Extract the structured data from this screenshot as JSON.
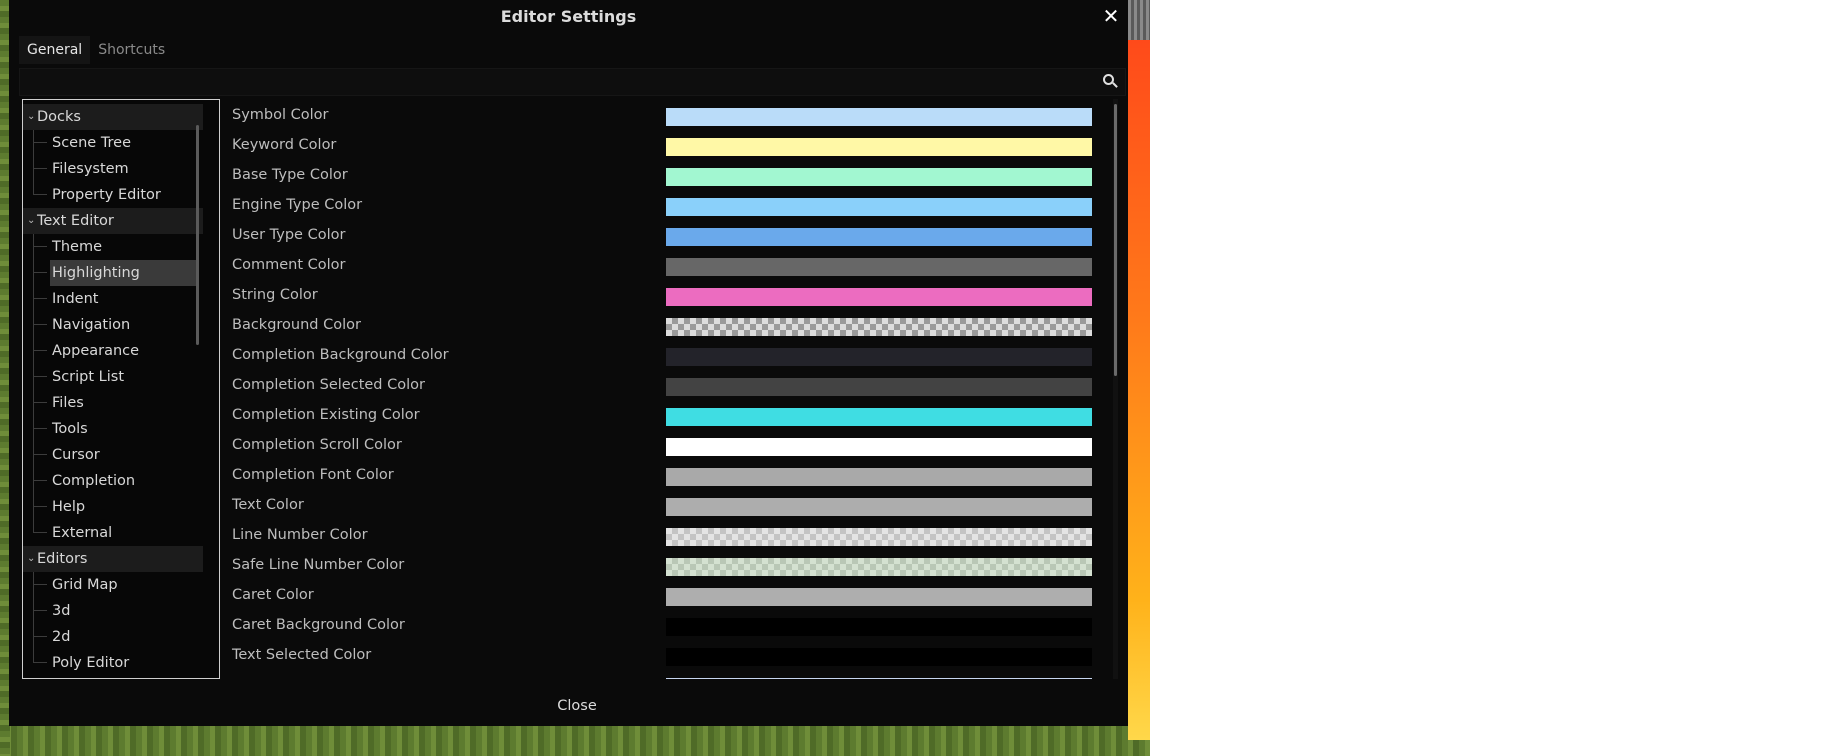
{
  "window": {
    "title": "Editor Settings"
  },
  "tabs": [
    {
      "label": "General",
      "active": true
    },
    {
      "label": "Shortcuts",
      "active": false
    }
  ],
  "search": {
    "value": "",
    "placeholder": ""
  },
  "tree": {
    "sections": [
      {
        "label": "Docks",
        "items": [
          "Scene Tree",
          "Filesystem",
          "Property Editor"
        ]
      },
      {
        "label": "Text Editor",
        "items": [
          "Theme",
          "Highlighting",
          "Indent",
          "Navigation",
          "Appearance",
          "Script List",
          "Files",
          "Tools",
          "Cursor",
          "Completion",
          "Help",
          "External"
        ]
      },
      {
        "label": "Editors",
        "items": [
          "Grid Map",
          "3d",
          "2d",
          "Poly Editor"
        ]
      }
    ],
    "selected": "Highlighting"
  },
  "properties": [
    {
      "label": "Symbol Color",
      "color": "#badcf9"
    },
    {
      "label": "Keyword Color",
      "color": "#fff8a6"
    },
    {
      "label": "Base Type Color",
      "color": "#a2f7d1"
    },
    {
      "label": "Engine Type Color",
      "color": "#8ad0fa"
    },
    {
      "label": "User Type Color",
      "color": "#6aa9eb"
    },
    {
      "label": "Comment Color",
      "color": "#676767"
    },
    {
      "label": "String Color",
      "color": "#ec6cc0"
    },
    {
      "label": "Background Color",
      "color": "checker"
    },
    {
      "label": "Completion Background Color",
      "color": "#23232a"
    },
    {
      "label": "Completion Selected Color",
      "color": "#434343"
    },
    {
      "label": "Completion Existing Color",
      "color": "#3fdde3"
    },
    {
      "label": "Completion Scroll Color",
      "color": "#ffffff"
    },
    {
      "label": "Completion Font Color",
      "color": "#a9a9a9"
    },
    {
      "label": "Text Color",
      "color": "#adadad"
    },
    {
      "label": "Line Number Color",
      "color": "checker-light"
    },
    {
      "label": "Safe Line Number Color",
      "color": "checker-green"
    },
    {
      "label": "Caret Color",
      "color": "#aeaeae"
    },
    {
      "label": "Caret Background Color",
      "color": "#000000"
    },
    {
      "label": "Text Selected Color",
      "color": "#000000"
    }
  ],
  "footer": {
    "close_label": "Close"
  }
}
